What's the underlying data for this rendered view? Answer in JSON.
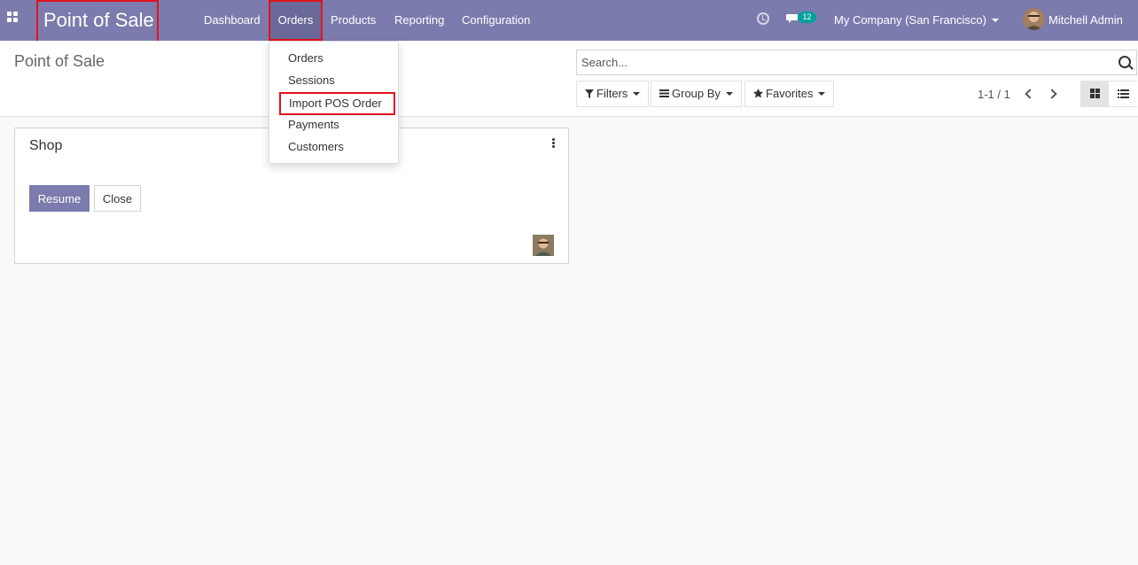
{
  "navbar": {
    "brand": "Point of Sale",
    "menu": [
      "Dashboard",
      "Orders",
      "Products",
      "Reporting",
      "Configuration"
    ],
    "active_menu": "Orders",
    "chat_count": "12",
    "company": "My Company (San Francisco)",
    "user": "Mitchell Admin"
  },
  "orders_dropdown": {
    "items": [
      "Orders",
      "Sessions",
      "Import POS Order",
      "Payments",
      "Customers"
    ],
    "highlighted": "Import POS Order"
  },
  "control_panel": {
    "breadcrumb": "Point of Sale",
    "search_placeholder": "Search...",
    "filters_label": "Filters",
    "groupby_label": "Group By",
    "favorites_label": "Favorites",
    "pager": "1-1 / 1"
  },
  "card": {
    "title": "Shop",
    "resume_label": "Resume",
    "close_label": "Close"
  },
  "colors": {
    "navbar": "#7c7bad",
    "primary_button": "#7c7bad",
    "highlight_border": "#e3121c",
    "badge": "#00a09d"
  },
  "icons": [
    "apps-icon",
    "clock-icon",
    "chat-icon",
    "search-icon",
    "filter-icon",
    "group-by-icon",
    "star-icon",
    "chevron-left-icon",
    "chevron-right-icon",
    "kanban-view-icon",
    "list-view-icon",
    "kebab-menu-icon"
  ]
}
